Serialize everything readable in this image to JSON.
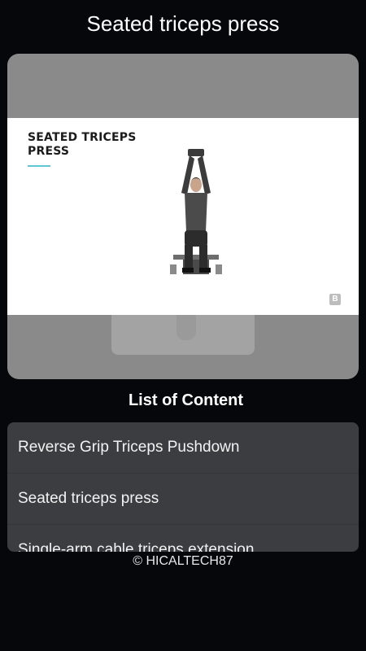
{
  "header": {
    "title": "Seated triceps press"
  },
  "video": {
    "overlay_title": "SEATED TRICEPS PRESS",
    "accent_color": "#5ec7d2",
    "brand_icon": "bodybuilding-logo-icon",
    "brand_letter": "B"
  },
  "content_list": {
    "heading": "List of Content",
    "items": [
      {
        "label": "Reverse Grip Triceps Pushdown"
      },
      {
        "label": "Seated triceps press"
      },
      {
        "label": "Single-arm cable triceps extension"
      }
    ]
  },
  "footer": {
    "text": "© HICALTECH87"
  }
}
